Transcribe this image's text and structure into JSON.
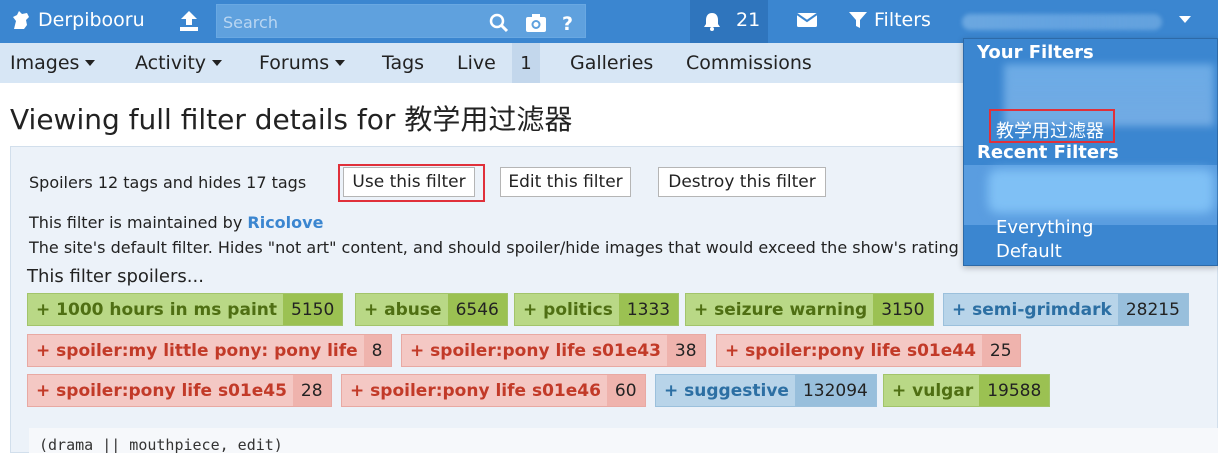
{
  "header": {
    "site_name": "Derpibooru",
    "search_placeholder": "Search",
    "notification_count": "21",
    "filters_label": "Filters"
  },
  "nav": {
    "items": [
      {
        "label": "Images",
        "has_dropdown": true
      },
      {
        "label": "Activity",
        "has_dropdown": true
      },
      {
        "label": "Forums",
        "has_dropdown": true
      },
      {
        "label": "Tags",
        "has_dropdown": false
      },
      {
        "label": "Live",
        "has_dropdown": false
      },
      {
        "label": "Galleries",
        "has_dropdown": false
      },
      {
        "label": "Commissions",
        "has_dropdown": false
      }
    ],
    "live_count": "1"
  },
  "page": {
    "title": "Viewing full filter details for 教学用过滤器",
    "summary": "Spoilers 12 tags and hides 17 tags",
    "buttons": {
      "use": "Use this filter",
      "edit": "Edit this filter",
      "destroy": "Destroy this filter"
    },
    "maintained_prefix": "This filter is maintained by ",
    "maintainer": "Ricolove",
    "description": "The site's default filter. Hides \"not art\" content, and should spoiler/hide images that would exceed the show's rating",
    "spoilers_heading": "This filter spoilers...",
    "code_snippet": "(drama || mouthpiece, edit)"
  },
  "spoiler_tags": [
    {
      "name": "+ 1000 hours in ms paint",
      "count": "5150",
      "category": "green"
    },
    {
      "name": "+ abuse",
      "count": "6546",
      "category": "green"
    },
    {
      "name": "+ politics",
      "count": "1333",
      "category": "green"
    },
    {
      "name": "+ seizure warning",
      "count": "3150",
      "category": "green"
    },
    {
      "name": "+ semi-grimdark",
      "count": "28215",
      "category": "blue"
    },
    {
      "name": "+ spoiler:my little pony: pony life",
      "count": "8",
      "category": "red"
    },
    {
      "name": "+ spoiler:pony life s01e43",
      "count": "38",
      "category": "red"
    },
    {
      "name": "+ spoiler:pony life s01e44",
      "count": "25",
      "category": "red"
    },
    {
      "name": "+ spoiler:pony life s01e45",
      "count": "28",
      "category": "red"
    },
    {
      "name": "+ spoiler:pony life s01e46",
      "count": "60",
      "category": "red"
    },
    {
      "name": "+ suggestive",
      "count": "132094",
      "category": "blue"
    },
    {
      "name": "+ vulgar",
      "count": "19588",
      "category": "green"
    }
  ],
  "dropdown": {
    "your_filters_heading": "Your Filters",
    "current_filter": "教学用过滤器",
    "recent_filters_heading": "Recent Filters",
    "recent": [
      "Everything",
      "Default"
    ]
  },
  "colors": {
    "header_bg": "#3b86d0",
    "nav_bg": "#d7e6f5",
    "highlight_box": "#e0303a",
    "tag_green": "#b9d886",
    "tag_blue": "#b8d4e9",
    "tag_red": "#f4c8c4"
  }
}
